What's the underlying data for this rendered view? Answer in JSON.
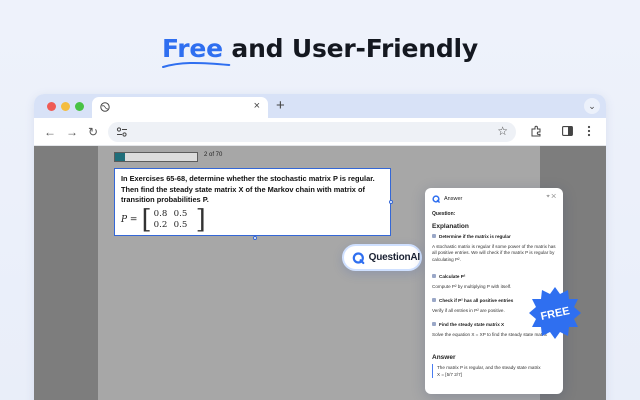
{
  "headline": {
    "accent": "Free",
    "rest": "and User-Friendly"
  },
  "browser": {
    "tab_close": "×",
    "new_tab": "+",
    "tab_menu": "⌄",
    "nav": {
      "back": "←",
      "forward": "→",
      "reload": "↻"
    },
    "star": "☆"
  },
  "quiz": {
    "progress_fraction": 0.12,
    "progress_label": "2 of 70",
    "question": "In Exercises 65-68, determine whether the stochastic matrix P is regular. Then find the steady state matrix X of the Markov chain with matrix of transition probabilities P.",
    "matrix_label": "P =",
    "matrix": [
      [
        "0.8",
        "0.5"
      ],
      [
        "0.2",
        "0.5"
      ]
    ]
  },
  "assistant": {
    "brand": "QuestionAI",
    "panel_title": "Answer",
    "question_label": "Question:",
    "explanation_title": "Explanation",
    "steps": [
      {
        "title": "Determine if the matrix is regular",
        "body": "A stochastic matrix is regular if some power of the matrix has all positive entries. We will check if the matrix P is regular by calculating P²."
      },
      {
        "title": "Calculate P²",
        "body": "Compute P² by multiplying P with itself."
      },
      {
        "title": "Check if P² has all positive entries",
        "body": "Verify if all entries in P² are positive."
      },
      {
        "title": "Find the steady state matrix X",
        "body": "Solve the equation X = XP to find the steady state matrix"
      }
    ],
    "answer_title": "Answer",
    "answer_text": "The matrix P is regular, and the steady state matrix X = [5/7 2/7]"
  },
  "badge": {
    "label": "FREE"
  },
  "colors": {
    "accent": "#2f6ff0",
    "badge": "#2f6ff0",
    "selection": "#3467d6"
  }
}
